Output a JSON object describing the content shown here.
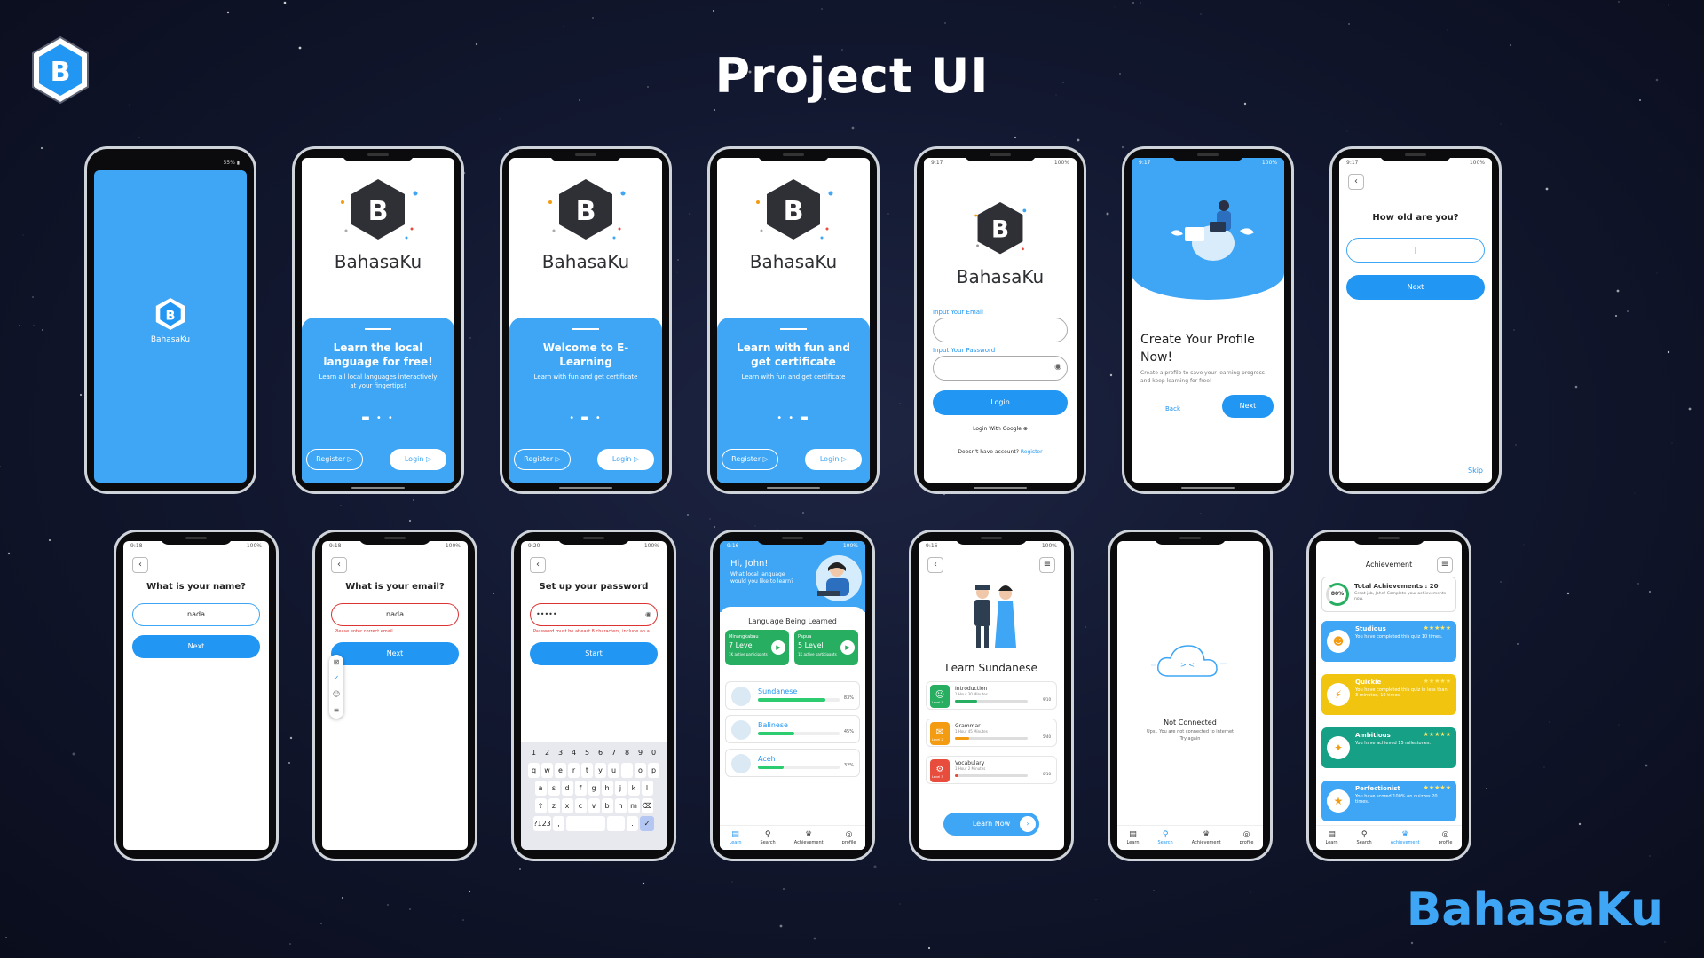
{
  "header": {
    "title": "Project UI",
    "brand": "BahasaKu"
  },
  "colors": {
    "primary": "#3ea6f5",
    "accent": "#2196f3",
    "error": "#dd3333",
    "green": "#27ae60",
    "orange": "#f39c12",
    "red": "#e74c3c",
    "yellow": "#f1c40f",
    "teal": "#16a085"
  },
  "splash": {
    "status": "55% ▮",
    "brand": "BahasaKu"
  },
  "onboard": [
    {
      "brand": "BahasaKu",
      "title": "Learn the local language for free!",
      "desc": "Learn all local languages interactively at your fingertips!",
      "register": "Register ▷",
      "login": "Login ▷"
    },
    {
      "brand": "BahasaKu",
      "title": "Welcome to E-Learning",
      "desc": "Learn with fun and get certificate",
      "register": "Register ▷",
      "login": "Login ▷"
    },
    {
      "brand": "BahasaKu",
      "title": "Learn with fun and get certificate",
      "desc": "Learn with fun and get certificate",
      "register": "Register ▷",
      "login": "Login ▷"
    }
  ],
  "login": {
    "time": "9:17",
    "battery": "100%",
    "brand": "BahasaKu",
    "email_label": "Input Your Email",
    "password_label": "Input Your Password",
    "login_button": "Login",
    "google": "Login With Google ⊕",
    "no_account": "Doesn't have account?",
    "register_link": "Register"
  },
  "profile": {
    "time": "9:17",
    "battery": "100%",
    "title": "Create Your Profile Now!",
    "desc": "Create a profile to save your learning progress and keep learning for free!",
    "back": "Back",
    "next": "Next"
  },
  "age": {
    "time": "9:17",
    "battery": "100%",
    "question": "How old are you?",
    "value": "|",
    "next": "Next",
    "skip": "Skip"
  },
  "name": {
    "time": "9:18",
    "battery": "100%",
    "question": "What is your name?",
    "value": "nada",
    "next": "Next"
  },
  "email": {
    "time": "9:18",
    "battery": "100%",
    "question": "What is your email?",
    "value": "nada",
    "error": "Please enter correct email",
    "next": "Next"
  },
  "password": {
    "time": "9:20",
    "battery": "100%",
    "question": "Set up your password",
    "value": "•••••",
    "error": "Password must be atleast 8 characters, include an a",
    "start": "Start",
    "keys": [
      [
        "1",
        "2",
        "3",
        "4",
        "5",
        "6",
        "7",
        "8",
        "9",
        "0"
      ],
      [
        "q",
        "w",
        "e",
        "r",
        "t",
        "y",
        "u",
        "i",
        "o",
        "p"
      ],
      [
        "a",
        "s",
        "d",
        "f",
        "g",
        "h",
        "j",
        "k",
        "l"
      ],
      [
        "⇧",
        "z",
        "x",
        "c",
        "v",
        "b",
        "n",
        "m",
        "⌫"
      ],
      [
        "?123",
        ",",
        "",
        "",
        ".",
        "✓"
      ]
    ]
  },
  "home": {
    "time": "9:16",
    "battery": "100%",
    "greeting": "Hi, John!",
    "prompt": "What local language would you like to learn?",
    "section": "Language Being Learned",
    "cards": [
      {
        "name": "Minangkabau",
        "level": "7 Level",
        "sub": "1K active participants"
      },
      {
        "name": "Papua",
        "level": "5 Level",
        "sub": "1K active participants"
      }
    ],
    "langs": [
      {
        "name": "Sundanese",
        "pct": "83%",
        "value": 0.83
      },
      {
        "name": "Balinese",
        "pct": "45%",
        "value": 0.45
      },
      {
        "name": "Aceh",
        "pct": "32%",
        "value": 0.32
      }
    ],
    "nav": [
      "Learn",
      "Search",
      "Achievement",
      "profile"
    ]
  },
  "detail": {
    "time": "9:16",
    "battery": "100%",
    "title": "Learn Sundanese",
    "levels": [
      {
        "name": "Introduction",
        "sub": "1 Hour 30 Minutes",
        "badge": "Level 1",
        "count": "9/10",
        "value": 0.3
      },
      {
        "name": "Grammar",
        "sub": "1 Hour 45 Minutes",
        "badge": "Level 2",
        "count": "5/40",
        "value": 0.2
      },
      {
        "name": "Vocabulary",
        "sub": "1 Hour 2 Minutes",
        "badge": "Level 3",
        "count": "0/10",
        "value": 0.05
      }
    ],
    "cta": "Learn Now"
  },
  "offline": {
    "title": "Not Connected",
    "desc": "Ups.. You are not connected to internet",
    "retry": "Try again",
    "nav": [
      "Learn",
      "Search",
      "Achievement",
      "profile"
    ]
  },
  "achievement": {
    "title": "Achievement",
    "total": "Total Achievements : 20",
    "total_desc": "Great job, John! Complete your achievements now.",
    "percent": "80%",
    "items": [
      {
        "name": "Studious",
        "desc": "You have completed this quiz 10 times.",
        "stars": "★★★★★"
      },
      {
        "name": "Quickie",
        "desc": "You have completed this quiz in less than 3 minutes, 10 times.",
        "stars": "★★★★★"
      },
      {
        "name": "Ambitious",
        "desc": "You have achieved 15 milestones.",
        "stars": "★★★★★"
      },
      {
        "name": "Perfectionist",
        "desc": "You have scored 100% on quizzes 20 times.",
        "stars": "★★★★★"
      }
    ],
    "nav": [
      "Learn",
      "Search",
      "Achievement",
      "profile"
    ]
  }
}
